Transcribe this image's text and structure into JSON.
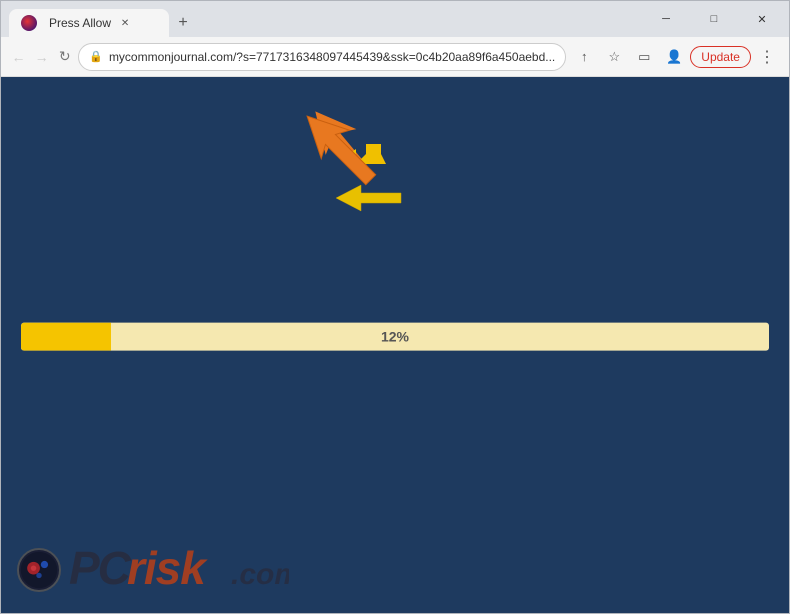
{
  "window": {
    "title": "Press Allow",
    "favicon": "browser-favicon"
  },
  "titlebar": {
    "tab_label": "Press Allow",
    "new_tab_label": "+",
    "controls": {
      "minimize": "─",
      "maximize": "□",
      "close": "✕"
    }
  },
  "toolbar": {
    "back_label": "←",
    "forward_label": "→",
    "reload_label": "↻",
    "address": "mycommonjournal.com/?s=7717316348097445439&ssk=0c4b20aa89f6a450aebd...",
    "share_icon": "↑",
    "bookmark_icon": "☆",
    "sidebar_icon": "▭",
    "profile_icon": "👤",
    "update_label": "Update",
    "menu_label": "⋮"
  },
  "progress": {
    "value": 12,
    "label": "12%",
    "fill_color": "#f5c400",
    "bg_color": "#f5e8b0"
  },
  "page": {
    "bg_color": "#1e3a5f"
  },
  "watermark": {
    "pc_text": "PC",
    "risk_text": "risk",
    "domain": ".com"
  }
}
